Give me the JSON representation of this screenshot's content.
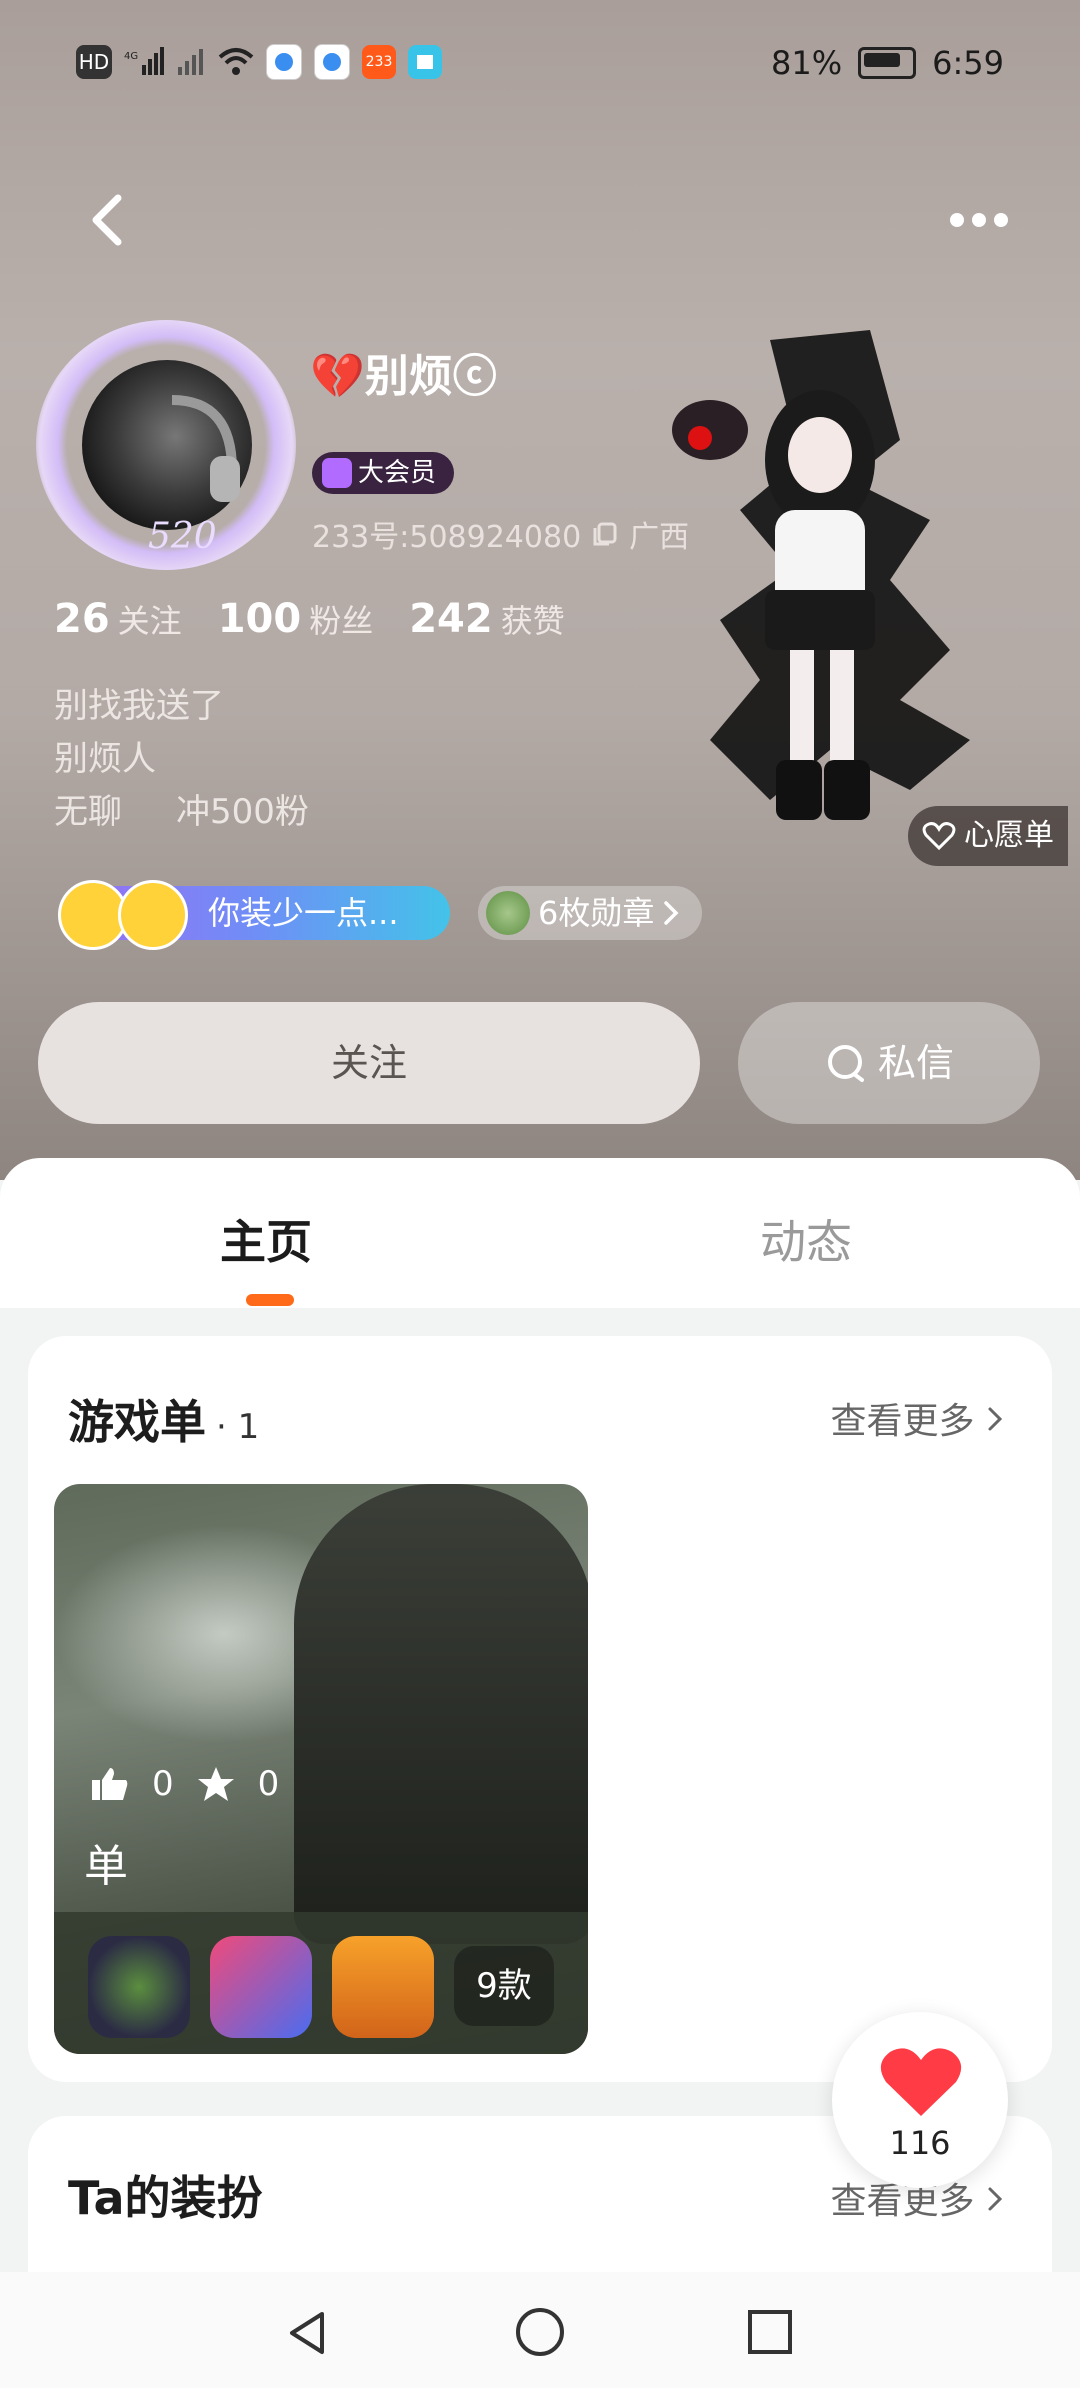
{
  "statusbar": {
    "left_icons": [
      "hd-icon",
      "signal-4g-icon",
      "signal-icon",
      "wifi-icon",
      "app-icon-1",
      "app-icon-2",
      "app-233-icon",
      "reader-icon"
    ],
    "hd_label": "HD",
    "app233_label": "233",
    "battery": "81%",
    "time": "6:59"
  },
  "profile": {
    "username": "💔别烦ⓒ",
    "vip_label": "大会员",
    "avatar_tag": "520",
    "uid": "233号:508924080",
    "location": "广西",
    "stats": [
      {
        "num": "26",
        "label": "关注"
      },
      {
        "num": "100",
        "label": "粉丝"
      },
      {
        "num": "242",
        "label": "获赞"
      }
    ],
    "bio": [
      "别找我送了",
      "别烦人",
      "无聊     冲500粉"
    ],
    "wishlist_label": "心愿单",
    "emoji_pill": "你装少一点...",
    "medals": "6枚勋章"
  },
  "actions": {
    "follow": "关注",
    "message": "私信"
  },
  "tabs": [
    {
      "label": "主页",
      "active": true
    },
    {
      "label": "动态",
      "active": false
    }
  ],
  "gamelist_card": {
    "title": "游戏单",
    "count": "· 1",
    "more": "查看更多",
    "tile": {
      "likes": "0",
      "stars": "0",
      "name": "单",
      "game_icons": [
        "watermelon-game-icon",
        "anime-girls-game-icon",
        "shovel-game-icon"
      ],
      "more_count": "9款"
    }
  },
  "outfit_card": {
    "title": "Ta的装扮",
    "more": "查看更多"
  },
  "like_fab": {
    "count": "116"
  },
  "colors": {
    "accent": "#ff6a1a",
    "vip": "#b26bff",
    "heart": "#ff3b45"
  }
}
